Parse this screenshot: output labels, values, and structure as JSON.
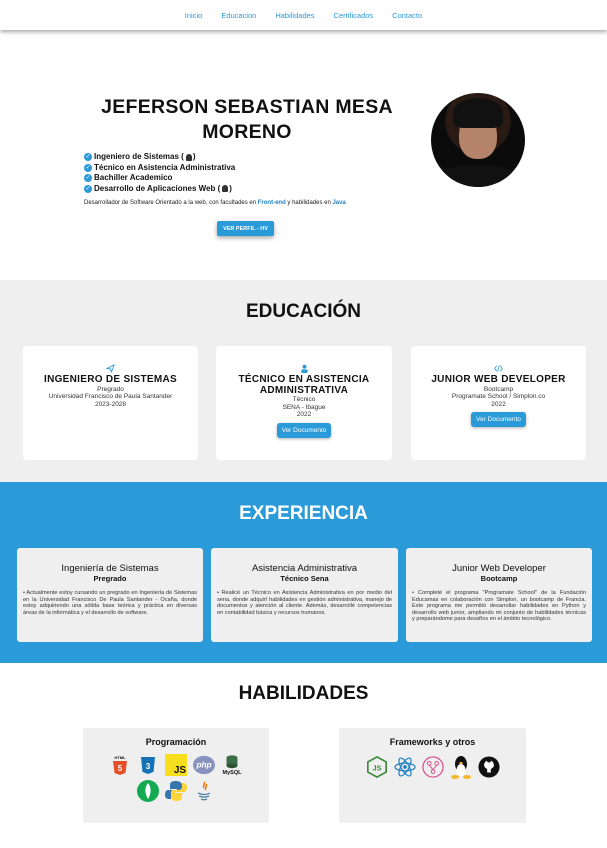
{
  "nav": {
    "items": [
      "Inicio",
      "Educacion",
      "Habilidades",
      "Certificados",
      "Contacto"
    ]
  },
  "hero": {
    "name": "JEFERSON SEBASTIAN MESA MORENO",
    "roles": [
      "Ingeniero de Sistemas (",
      "Técnico en Asistencia Administrativa",
      "Bachiller Academico",
      "Desarrollo de Aplicaciones Web ("
    ],
    "role_suffix": ")",
    "tagline_pre": "Desarrollador de Software Orientado a la web, con facultades en ",
    "tagline_hl1": "Front-end",
    "tagline_mid": " y habilidades en ",
    "tagline_hl2": "Java",
    "cv_button": "VER PERFIL - HV",
    "accent": "#2b9ad9"
  },
  "education": {
    "title": "EDUCACIÓN",
    "cards": [
      {
        "icon": "paper-plane-icon",
        "title": "INGENIERO DE SISTEMAS",
        "type": "Pregrado",
        "institution": "Universidad Francisco de Paula Santander",
        "years": "2023-2028",
        "button": ""
      },
      {
        "icon": "user-icon",
        "title": "TÉCNICO EN ASISTENCIA ADMINISTRATIVA",
        "type": "Técnico",
        "institution": "SENA - Ibague",
        "years": "2022",
        "button": "Ver Documento"
      },
      {
        "icon": "code-icon",
        "title": "JUNIOR WEB DEVELOPER",
        "type": "Bootcamp",
        "institution": "Programate School / Simplon.co",
        "years": "2022",
        "button": "Ver Documento"
      }
    ]
  },
  "experience": {
    "title": "EXPERIENCIA",
    "cards": [
      {
        "title": "Ingeniería de Sistemas",
        "subtitle": "Pregrado",
        "text": "• Actualmente estoy cursando un pregrado en Ingeniería de Sistemas en la Universidad Francisco De Paula Santander - Ocaña, donde estoy adquiriendo una sólida base teórica y práctica en diversas áreas de la informática y el desarrollo de software."
      },
      {
        "title": "Asistencia Administrativa",
        "subtitle": "Técnico Sena",
        "text": "• Realicé un Técnico en Asistencia Administrativa en por medio del sena, donde adquirí habilidades en gestión administrativa, manejo de documentos y atención al cliente. Además, desarrollé competencias en contabilidad básica y recursos humanos."
      },
      {
        "title": "Junior Web Developer",
        "subtitle": "Bootcamp",
        "text": "• Completé el programa \"Programate School\" de la Fundación Educamas en colaboración con Simplon, un bootcamp de Francia. Este programa me permitió desarrollar habilidades en Python y desarrollo web junior, ampliando mi conjunto de habilidades técnicas y preparándome para desafíos en el ámbito tecnológico."
      }
    ]
  },
  "skills": {
    "title": "HABILIDADES",
    "programming": {
      "title": "Programación",
      "icons": [
        "html5-icon",
        "css3-icon",
        "js-icon",
        "php-icon",
        "mysql-icon",
        "mongodb-icon",
        "python-icon",
        "java-icon"
      ],
      "labels": {
        "html": "HTML",
        "js": "JS",
        "php": "php",
        "mysql": "MySQL"
      }
    },
    "frameworks": {
      "title": "Frameworks y otros",
      "icons": [
        "nodejs-icon",
        "react-icon",
        "git-icon",
        "linux-icon",
        "github-icon"
      ],
      "labels": {
        "node": "JS"
      }
    }
  }
}
